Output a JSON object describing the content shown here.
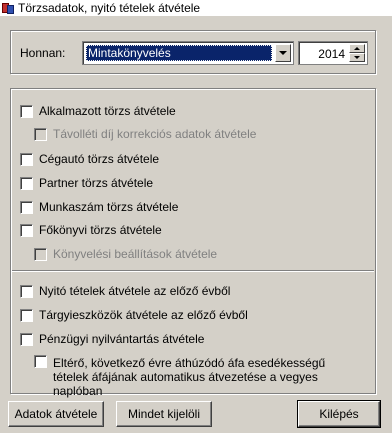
{
  "window": {
    "title": "Törzsadatok, nyitó tételek átvétele"
  },
  "source": {
    "label": "Honnan:",
    "selected": "Mintakönyvelés",
    "year": "2014"
  },
  "options": [
    {
      "label": "Alkalmazott törzs átvétele",
      "checked": false,
      "enabled": true
    },
    {
      "label": "Távolléti díj korrekciós adatok átvétele",
      "checked": false,
      "enabled": false
    },
    {
      "label": "Cégautó törzs átvétele",
      "checked": false,
      "enabled": true
    },
    {
      "label": "Partner törzs átvétele",
      "checked": false,
      "enabled": true
    },
    {
      "label": "Munkaszám törzs átvétele",
      "checked": false,
      "enabled": true
    },
    {
      "label": "Főkönyvi törzs átvétele",
      "checked": false,
      "enabled": true
    },
    {
      "label": "Könyvelési beállítások átvétele",
      "checked": false,
      "enabled": false
    },
    {
      "label": "Nyitó tételek átvétele az előző évből",
      "checked": false,
      "enabled": true
    },
    {
      "label": "Tárgyieszközök átvétele az előző évből",
      "checked": false,
      "enabled": true
    },
    {
      "label": "Pénzügyi nyilvántartás átvétele",
      "checked": false,
      "enabled": true
    },
    {
      "label": "Eltérő, következő évre áthúzódó áfa esedékességű tételek áfájának automatikus átvezetése a vegyes naplóban",
      "checked": false,
      "enabled": true
    }
  ],
  "buttons": {
    "import": "Adatok átvétele",
    "select_all": "Mindet kijelöli",
    "exit": "Kilépés"
  }
}
